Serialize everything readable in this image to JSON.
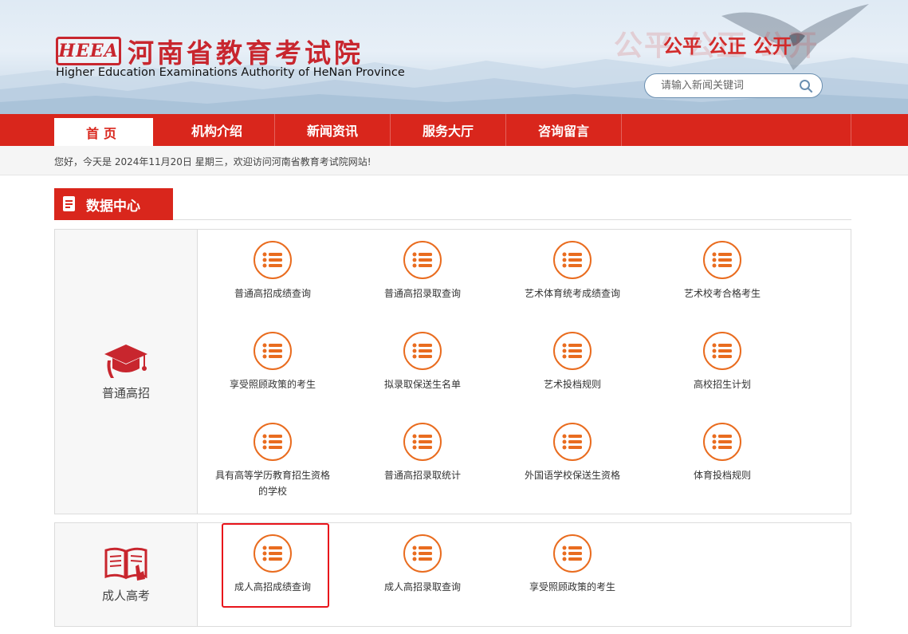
{
  "header": {
    "logo_mark": "HEEA",
    "title_cn": "河南省教育考试院",
    "title_en": "Higher Education Examinations Authority of HeNan Province",
    "slogan": "公平 公正 公开",
    "search_placeholder": "请输入新闻关键词"
  },
  "nav": {
    "items": [
      {
        "label": "首页"
      },
      {
        "label": "机构介绍"
      },
      {
        "label": "新闻资讯"
      },
      {
        "label": "服务大厅"
      },
      {
        "label": "咨询留言"
      }
    ]
  },
  "info_bar": {
    "greeting": "您好，今天是 2024年11月20日 星期三，欢迎访问河南省教育考试院网站!"
  },
  "section": {
    "title": "数据中心"
  },
  "panels": [
    {
      "category": "普通高招",
      "icon": "graduation-cap-icon",
      "items": [
        {
          "label": "普通高招成绩查询"
        },
        {
          "label": "普通高招录取查询"
        },
        {
          "label": "艺术体育统考成绩查询"
        },
        {
          "label": "艺术校考合格考生"
        },
        {
          "label": "享受照顾政策的考生"
        },
        {
          "label": "拟录取保送生名单"
        },
        {
          "label": "艺术投档规则"
        },
        {
          "label": "高校招生计划"
        },
        {
          "label": "具有高等学历教育招生资格的学校"
        },
        {
          "label": "普通高招录取统计"
        },
        {
          "label": "外国语学校保送生资格"
        },
        {
          "label": "体育投档规则"
        }
      ]
    },
    {
      "category": "成人高考",
      "icon": "open-book-icon",
      "items": [
        {
          "label": "成人高招成绩查询"
        },
        {
          "label": "成人高招录取查询"
        },
        {
          "label": "享受照顾政策的考生"
        }
      ]
    }
  ],
  "colors": {
    "brand_red": "#d9261c",
    "tile_orange": "#e96c1f",
    "highlight_red": "#e8141b"
  }
}
